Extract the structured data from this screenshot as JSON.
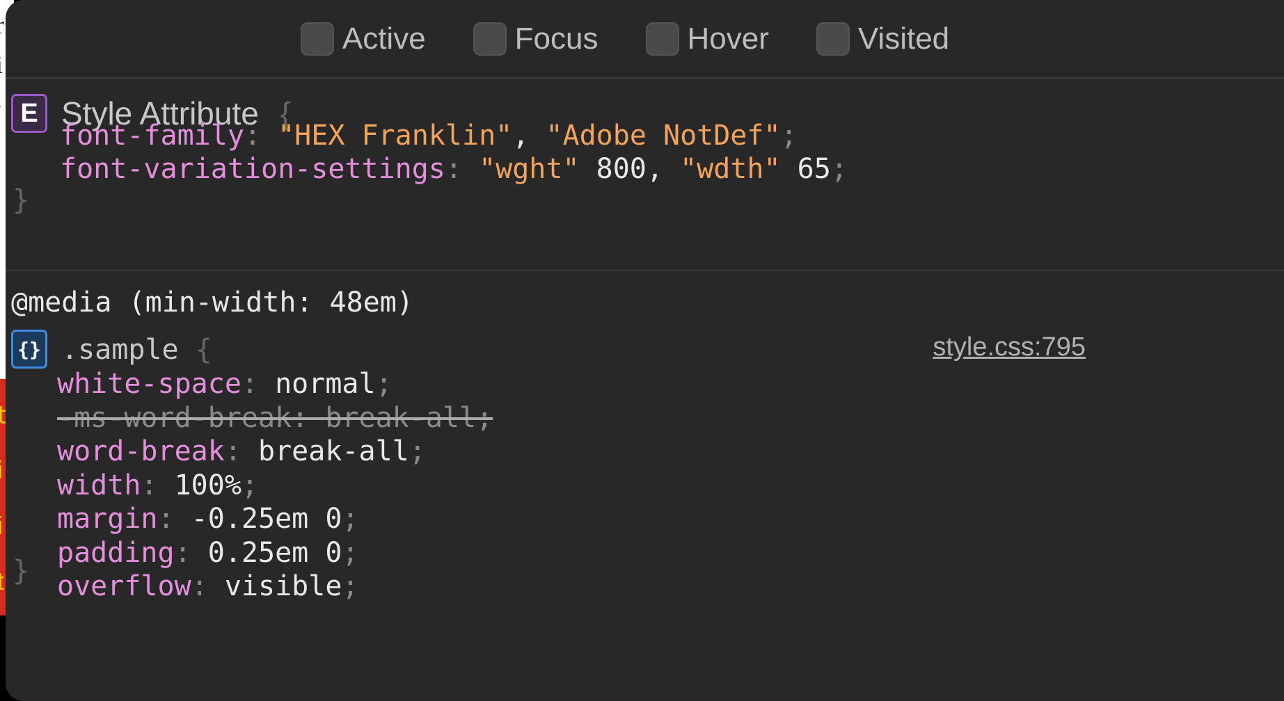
{
  "background": {
    "glyphs": [
      "r",
      "i",
      "."
    ],
    "red_glyphs": [
      "t",
      "i",
      "i",
      "t"
    ]
  },
  "pseudo_classes": [
    "Active",
    "Focus",
    "Hover",
    "Visited"
  ],
  "style_attribute": {
    "badge": "E",
    "selector": "Style Attribute",
    "open_brace": "{",
    "close_brace": "}",
    "declarations": [
      {
        "property": "font-family",
        "value_parts": [
          {
            "kind": "str",
            "text": "\"HEX Franklin\""
          },
          {
            "kind": "val",
            "text": ", "
          },
          {
            "kind": "str",
            "text": "\"Adobe NotDef\""
          }
        ]
      },
      {
        "property": "font-variation-settings",
        "value_parts": [
          {
            "kind": "str",
            "text": "\"wght\""
          },
          {
            "kind": "val",
            "text": " 800, "
          },
          {
            "kind": "str",
            "text": "\"wdth\""
          },
          {
            "kind": "val",
            "text": " 65"
          }
        ]
      }
    ]
  },
  "media_rule": {
    "media_query": "@media (min-width: 48em)",
    "badge": "{}",
    "selector": ".sample",
    "open_brace": "{",
    "close_brace": "}",
    "source": "style.css:795",
    "declarations": [
      {
        "property": "white-space",
        "value": "normal",
        "overridden": false
      },
      {
        "property": "-ms-word-break",
        "value": "break-all",
        "overridden": true
      },
      {
        "property": "word-break",
        "value": "break-all",
        "overridden": false
      },
      {
        "property": "width",
        "value": "100%",
        "overridden": false
      },
      {
        "property": "margin",
        "value": "-0.25em 0",
        "overridden": false
      },
      {
        "property": "padding",
        "value": "0.25em 0",
        "overridden": false
      },
      {
        "property": "overflow",
        "value": "visible",
        "overridden": false
      }
    ]
  },
  "colors": {
    "panel_bg": "#282828",
    "property": "#e58fdc",
    "string": "#f4a458",
    "value": "#e8e8e8",
    "element_badge": "#9b59c9",
    "rule_badge": "#3f8be0"
  }
}
